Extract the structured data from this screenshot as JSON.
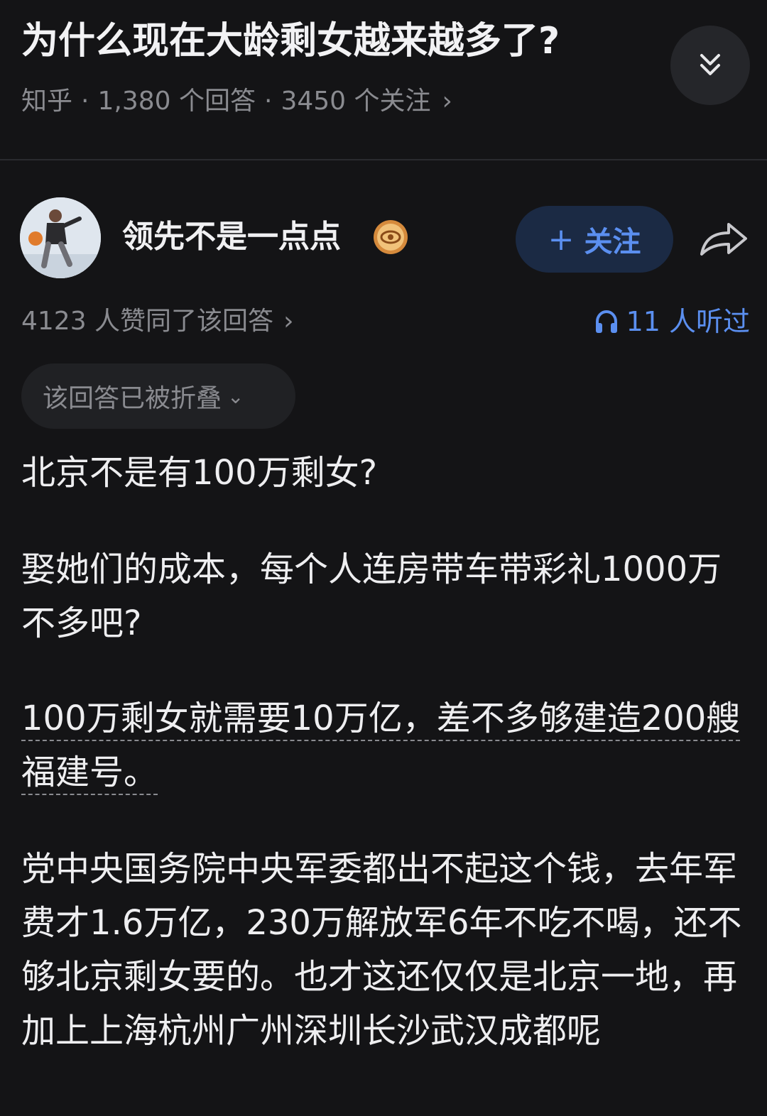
{
  "question": {
    "title": "为什么现在大龄剩女越来越多了?",
    "source": "知乎",
    "answers": "1,380 个回答",
    "followers": "3450 个关注",
    "chevron": "›"
  },
  "author": {
    "name": "领先不是一点点",
    "follow_label": "关注",
    "follow_plus": "+"
  },
  "stats": {
    "upvotes": "4123 人赞同了该回答",
    "chevron": "›",
    "listened": "11 人听过"
  },
  "folded": {
    "label": "该回答已被折叠",
    "caret": "⌄"
  },
  "content": {
    "p1": "北京不是有100万剩女?",
    "p2": "娶她们的成本，每个人连房带车带彩礼1000万不多吧?",
    "p3": "100万剩女就需要10万亿，差不多够建造200艘福建号。",
    "p4": "党中央国务院中央军委都出不起这个钱，去年军费才1.6万亿，230万解放军6年不吃不喝，还不够北京剩女要的。也才这还仅仅是北京一地，再加上上海杭州广州深圳长沙武汉成都呢"
  },
  "colors": {
    "background": "#141416",
    "accent": "#5b8ff0",
    "muted": "#8a8b90"
  },
  "icons": {
    "expand": "double-chevron-down-icon",
    "badge": "eye-badge-icon",
    "share": "share-arrow-icon",
    "headphones": "headphones-icon"
  }
}
